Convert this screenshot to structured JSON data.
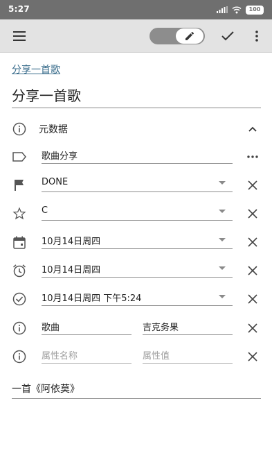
{
  "status_bar": {
    "time": "5:27",
    "battery": "100"
  },
  "app_bar": {
    "menu_icon": "hamburger-menu-icon",
    "edit_icon": "pencil-icon",
    "confirm_icon": "check-icon",
    "more_icon": "more-vert-icon"
  },
  "note": {
    "link_title": "分享一首歌",
    "title": "分享一首歌",
    "metadata": {
      "label": "元数据",
      "tags": "歌曲分享",
      "status": "DONE",
      "priority": "C",
      "scheduled": "10月14日周四",
      "deadline": "10月14日周四",
      "closed": "10月14日周四 下午5:24",
      "property": {
        "name": "歌曲",
        "value": "吉克务果"
      },
      "new_property": {
        "name_placeholder": "属性名称",
        "value_placeholder": "属性值"
      }
    },
    "body": "一首《阿依莫》"
  }
}
